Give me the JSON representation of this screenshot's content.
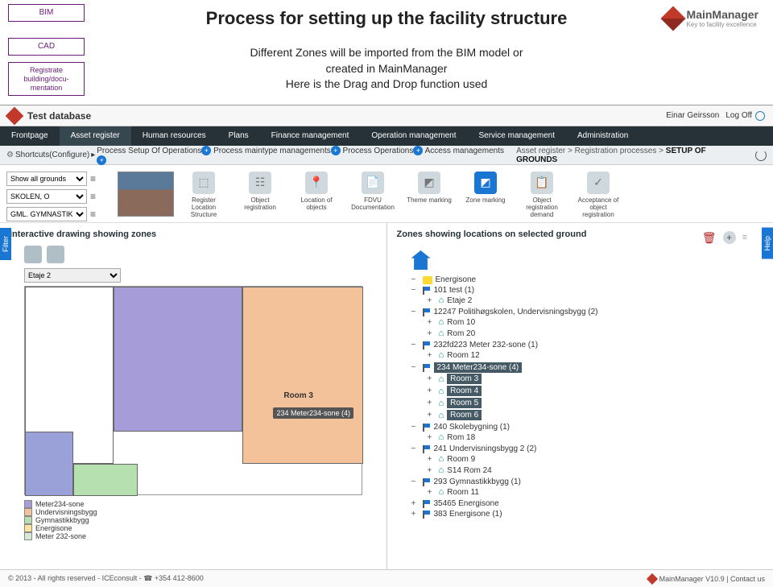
{
  "slide": {
    "flow": {
      "bim": "BIM",
      "cad": "CAD",
      "reg": "Registrate building/docu-mentation"
    },
    "title": "Process for setting up the facility structure",
    "subtitle": "Different Zones will be imported from the BIM model or\ncreated in MainManager\nHere is the Drag and Drop function used",
    "brand": {
      "name": "MainManager",
      "tag": "Key to facility excellence"
    }
  },
  "app": {
    "db": "Test database",
    "user": "Einar Geirsson",
    "logoff": "Log Off",
    "nav": [
      "Frontpage",
      "Asset register",
      "Human resources",
      "Plans",
      "Finance management",
      "Operation management",
      "Service management",
      "Administration"
    ],
    "subnav": {
      "configure": "Shortcuts(Configure)",
      "crumbs": [
        "Process Setup Of Operations",
        "Process maintype managements",
        "Process Operations",
        "Access managements"
      ],
      "breadcrumb": [
        "Asset register",
        "Registration processes",
        "SETUP OF GROUNDS"
      ]
    },
    "pickers": {
      "a": "Show all grounds",
      "b": "SKOLEN, O",
      "c": "GML. GYMNASTIKKB"
    },
    "toolbar": [
      {
        "label": "Register Location Structure",
        "icon": "⬚"
      },
      {
        "label": "Object registration",
        "icon": "☷"
      },
      {
        "label": "Location of objects",
        "icon": "📍"
      },
      {
        "label": "FDVU Documentation",
        "icon": "📄"
      },
      {
        "label": "Theme marking",
        "icon": "◩"
      },
      {
        "label": "Zone marking",
        "icon": "◩",
        "hot": true
      },
      {
        "label": "Object registration demand",
        "icon": "📋"
      },
      {
        "label": "Acceptance of object registration",
        "icon": "✓"
      }
    ],
    "left": {
      "sideTab": "Filter",
      "title": "Interactive drawing showing zones",
      "floor": "Etaje 2",
      "roomLabel": "Room 3",
      "dragTip": "234 Meter234-sone (4)",
      "legend": [
        {
          "c": "#a59cd8",
          "t": "Meter234-sone"
        },
        {
          "c": "#f4c29a",
          "t": "Undervisningsbygg"
        },
        {
          "c": "#b7e0b0",
          "t": "Gymnastikkbygg"
        },
        {
          "c": "#ffe59a",
          "t": "Energisone"
        },
        {
          "c": "#d7ead7",
          "t": "Meter 232-sone"
        }
      ]
    },
    "right": {
      "sideTab": "Help",
      "title": "Zones showing locations on selected ground",
      "tree": [
        {
          "t": "folder",
          "label": "Energisone",
          "open": true
        },
        {
          "t": "flag",
          "label": "101 test (1)",
          "children": [
            {
              "t": "room",
              "label": "Etaje 2"
            }
          ]
        },
        {
          "t": "flag",
          "label": "12247 Politihøgskolen, Undervisningsbygg (2)",
          "children": [
            {
              "t": "room",
              "label": "Rom 10"
            },
            {
              "t": "room",
              "label": "Rom 20"
            }
          ]
        },
        {
          "t": "flag",
          "label": "232fd223 Meter 232-sone (1)",
          "children": [
            {
              "t": "room",
              "label": "Room 12"
            }
          ]
        },
        {
          "t": "flag",
          "label": "234 Meter234-sone (4)",
          "highlight": true,
          "children": [
            {
              "t": "room",
              "label": "Room 3"
            },
            {
              "t": "room",
              "label": "Room 4"
            },
            {
              "t": "room",
              "label": "Room 5"
            },
            {
              "t": "room",
              "label": "Room 6"
            }
          ]
        },
        {
          "t": "flag",
          "label": "240 Skolebygning (1)",
          "children": [
            {
              "t": "room",
              "label": "Rom 18"
            }
          ]
        },
        {
          "t": "flag",
          "label": "241 Undervisningsbygg 2 (2)",
          "children": [
            {
              "t": "room",
              "label": "Room 9"
            },
            {
              "t": "room",
              "label": "S14 Rom 24"
            }
          ]
        },
        {
          "t": "flag",
          "label": "293 Gymnastikkbygg (1)",
          "children": [
            {
              "t": "room",
              "label": "Room 11"
            }
          ]
        },
        {
          "t": "flag",
          "label": "35465 Energisone"
        },
        {
          "t": "flag",
          "label": "383 Energisone (1)"
        }
      ]
    },
    "footer": {
      "left": "© 2013 - All rights reserved - ICEconsult - ☎ +354 412-8600",
      "right": "MainManager V10.9  |  Contact us"
    }
  }
}
